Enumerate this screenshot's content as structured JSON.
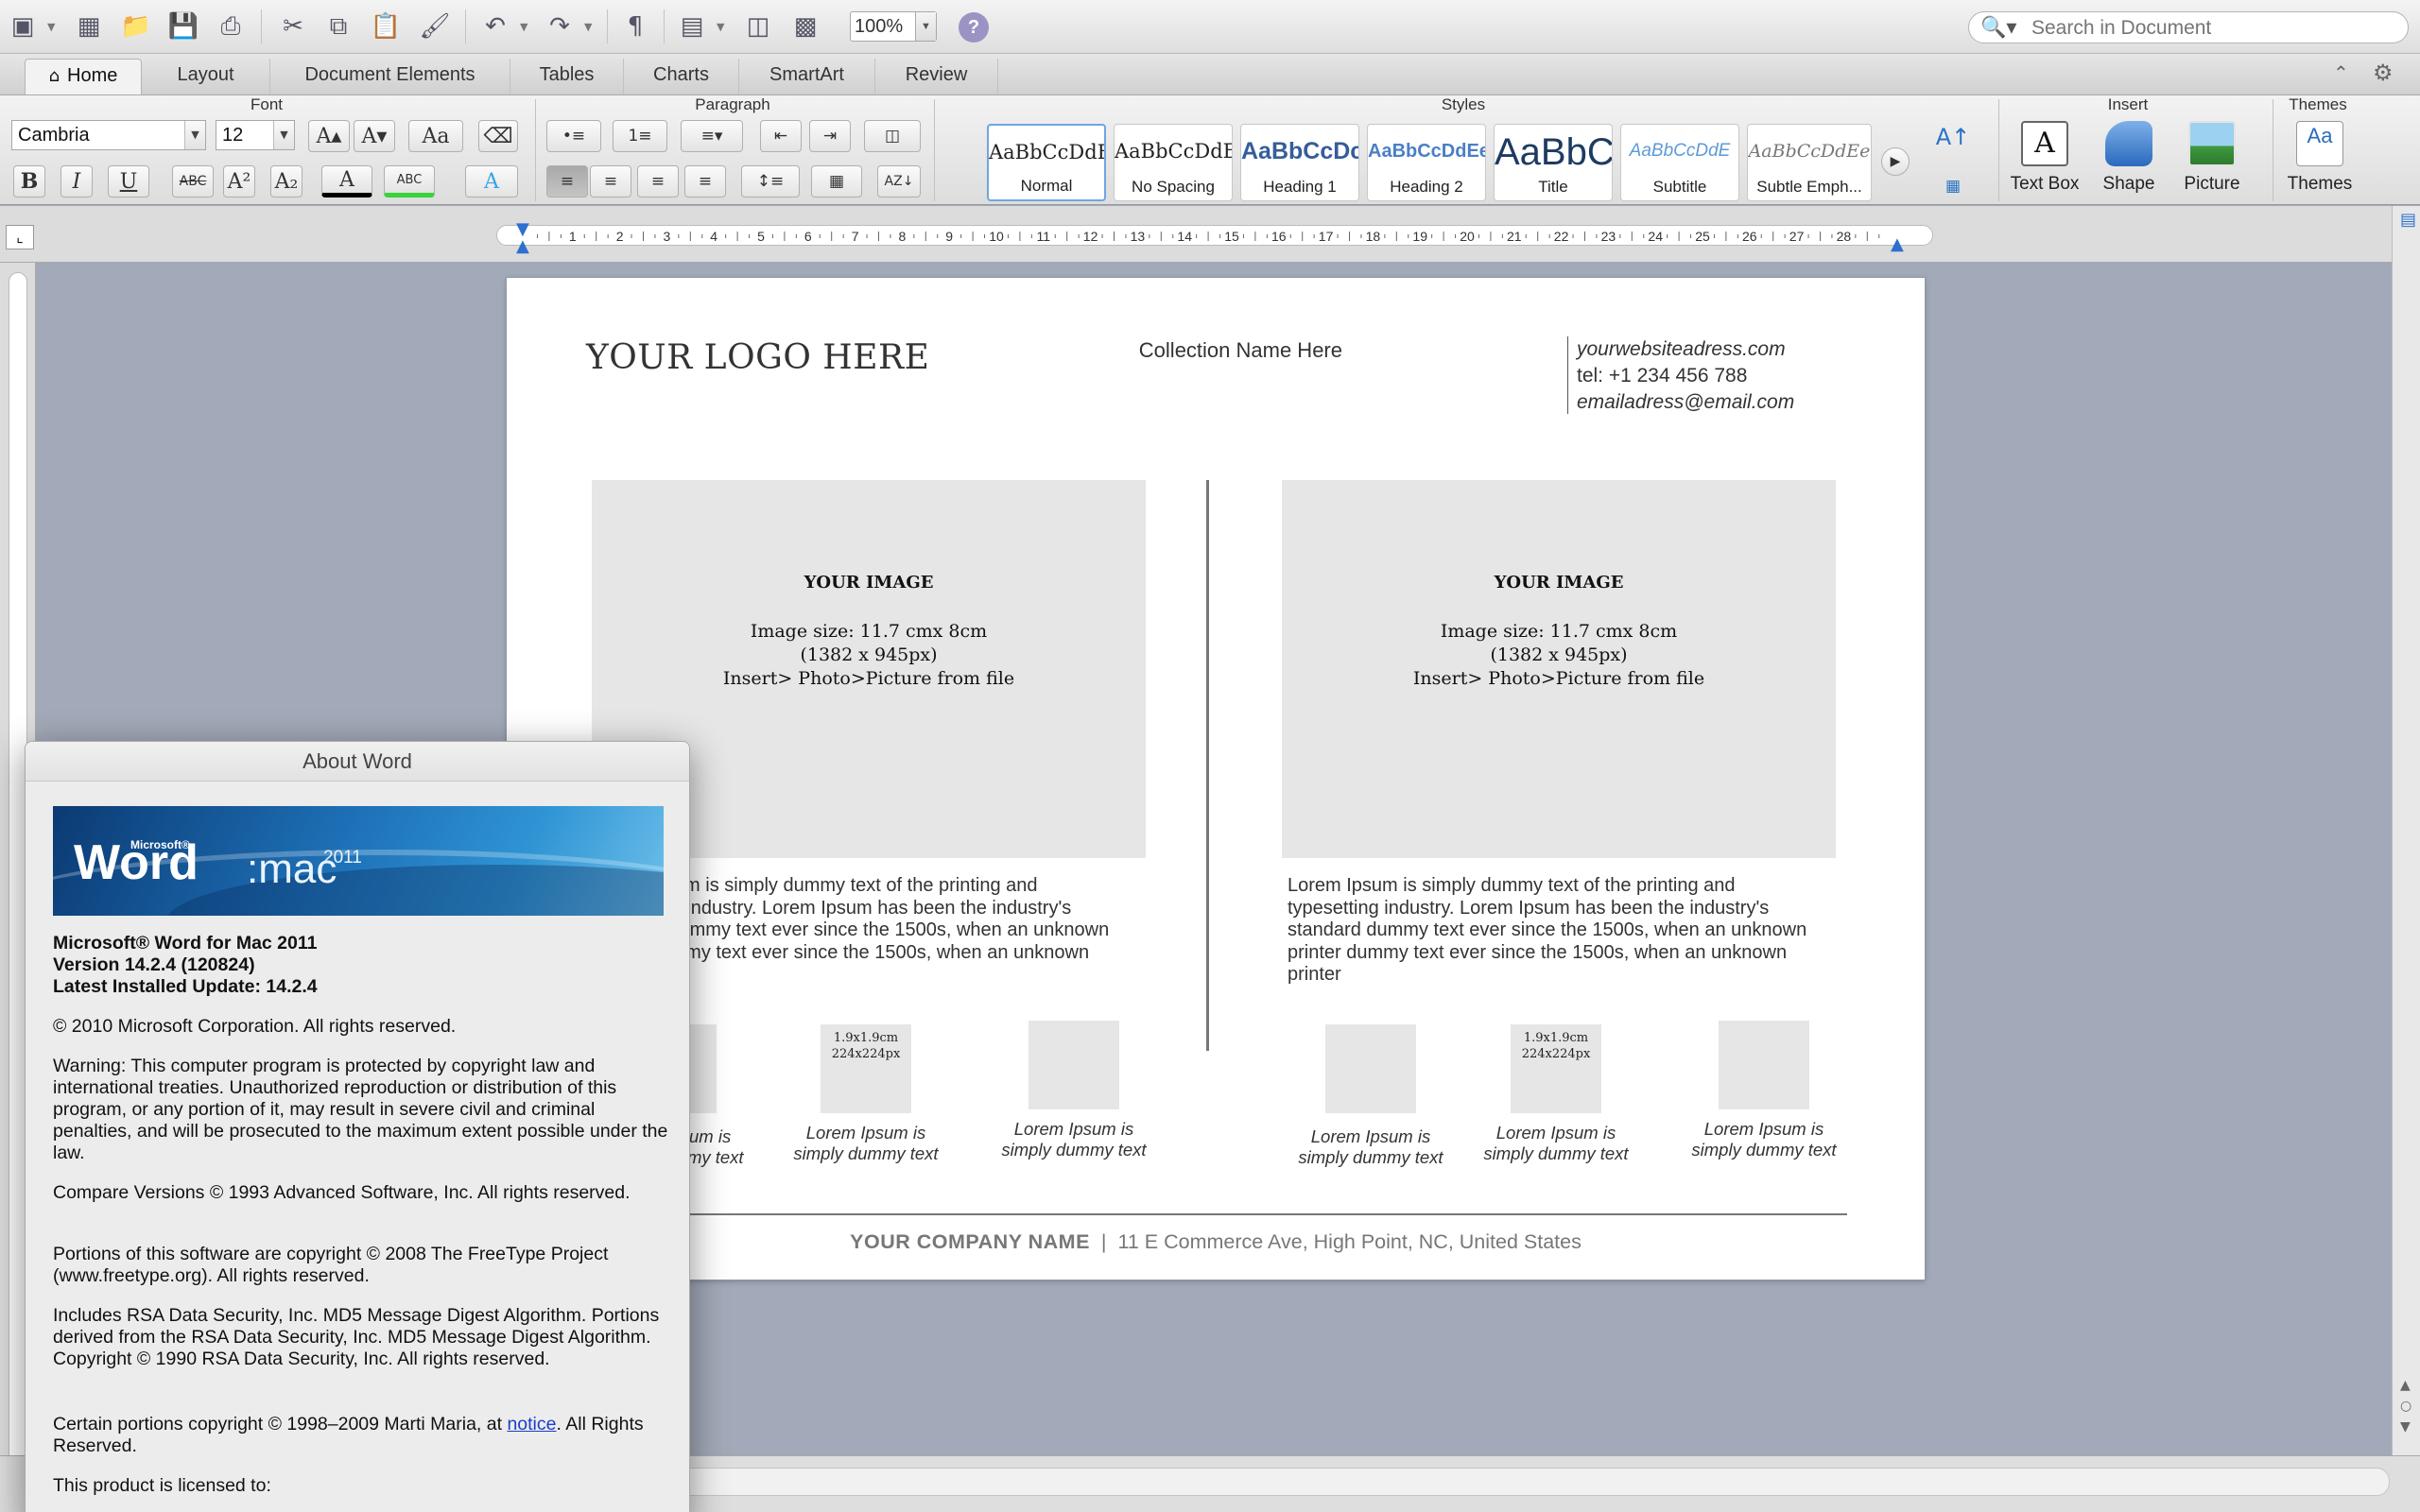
{
  "toolbar": {
    "zoom": "100%",
    "search_placeholder": "Search in Document"
  },
  "ribbon_tabs": [
    "Home",
    "Layout",
    "Document Elements",
    "Tables",
    "Charts",
    "SmartArt",
    "Review"
  ],
  "ribbon": {
    "font_group": "Font",
    "paragraph_group": "Paragraph",
    "styles_group": "Styles",
    "insert_group": "Insert",
    "themes_group": "Themes",
    "font_name": "Cambria",
    "font_size": "12",
    "styles": [
      {
        "sample": "AaBbCcDdEe",
        "label": "Normal"
      },
      {
        "sample": "AaBbCcDdEe",
        "label": "No Spacing"
      },
      {
        "sample": "AaBbCcDc",
        "label": "Heading 1"
      },
      {
        "sample": "AaBbCcDdEe",
        "label": "Heading 2"
      },
      {
        "sample": "AaBbC",
        "label": "Title"
      },
      {
        "sample": "AaBbCcDdE",
        "label": "Subtitle"
      },
      {
        "sample": "AaBbCcDdEe",
        "label": "Subtle Emph..."
      }
    ],
    "insert_items": [
      "Text Box",
      "Shape",
      "Picture"
    ],
    "themes_label": "Themes",
    "themes_sample": "Aa"
  },
  "document": {
    "logo": "YOUR LOGO HERE",
    "collection": "Collection Name Here",
    "website": "yourwebsiteadress.com",
    "tel": "tel: +1 234 456 788",
    "email": "emailadress@email.com",
    "image_left": {
      "title": "YOUR IMAGE",
      "lines": [
        "Image size: 11.7 cmx 8cm",
        "(1382 x 945px)",
        "Insert> Photo>Picture from file"
      ]
    },
    "image_right": {
      "title": "YOUR IMAGE",
      "lines": [
        "Image size: 11.7 cmx 8cm",
        "(1382 x 945px)",
        "Insert> Photo>Picture from file"
      ]
    },
    "lorem_left_lines": [
      "Lorem Ipsum is simply dummy text of the printing and",
      "typesetting industry. Lorem Ipsum has been the industry's",
      "standard dummy text ever since the 1500s, when an unknown",
      "printer dummy text ever since the 1500s, when an unknown"
    ],
    "lorem_right_lines": [
      "Lorem Ipsum is simply dummy text of the printing and",
      "typesetting industry. Lorem Ipsum has been the industry's",
      "standard dummy text ever since the 1500s, when an unknown",
      "printer dummy text ever since the 1500s, when an unknown",
      "printer"
    ],
    "thumb_label_1": "1.9x1.9cm",
    "thumb_label_2": "224x224px",
    "thumb_caption_1": "Lorem Ipsum is",
    "thumb_caption_2": "simply dummy text",
    "company": "YOUR COMPANY NAME",
    "separator": "|",
    "address": "11 E Commerce Ave, High Point, NC, United States"
  },
  "about": {
    "title": "About Word",
    "banner_brand": "Microsoft®",
    "banner_word": "Word",
    "banner_mac": ":mac",
    "banner_year": "2011",
    "product": "Microsoft® Word for Mac 2011",
    "version": "Version 14.2.4 (120824)",
    "update": "Latest Installed Update: 14.2.4",
    "copyright": "© 2010 Microsoft Corporation. All rights reserved.",
    "warning": "Warning: This computer program is protected by copyright law and international treaties.  Unauthorized reproduction or distribution of this program, or any portion of it, may result in severe civil and criminal penalties, and will be prosecuted to the maximum extent possible under the law.",
    "compare": "Compare Versions © 1993 Advanced Software, Inc.  All rights reserved.",
    "freetype": "Portions of this software are copyright © 2008 The FreeType Project (www.freetype.org).  All rights reserved.",
    "rsa": "Includes RSA Data Security, Inc. MD5 Message Digest Algorithm.  Portions derived from the RSA Data Security, Inc. MD5 Message Digest Algorithm.  Copyright © 1990 RSA Data Security, Inc. All rights reserved.",
    "maria_prefix": "Certain portions copyright © 1998–2009  Marti Maria, at ",
    "maria_link": "notice",
    "maria_suffix": ".  All Rights Reserved.",
    "licensed": "This product is licensed to:"
  }
}
